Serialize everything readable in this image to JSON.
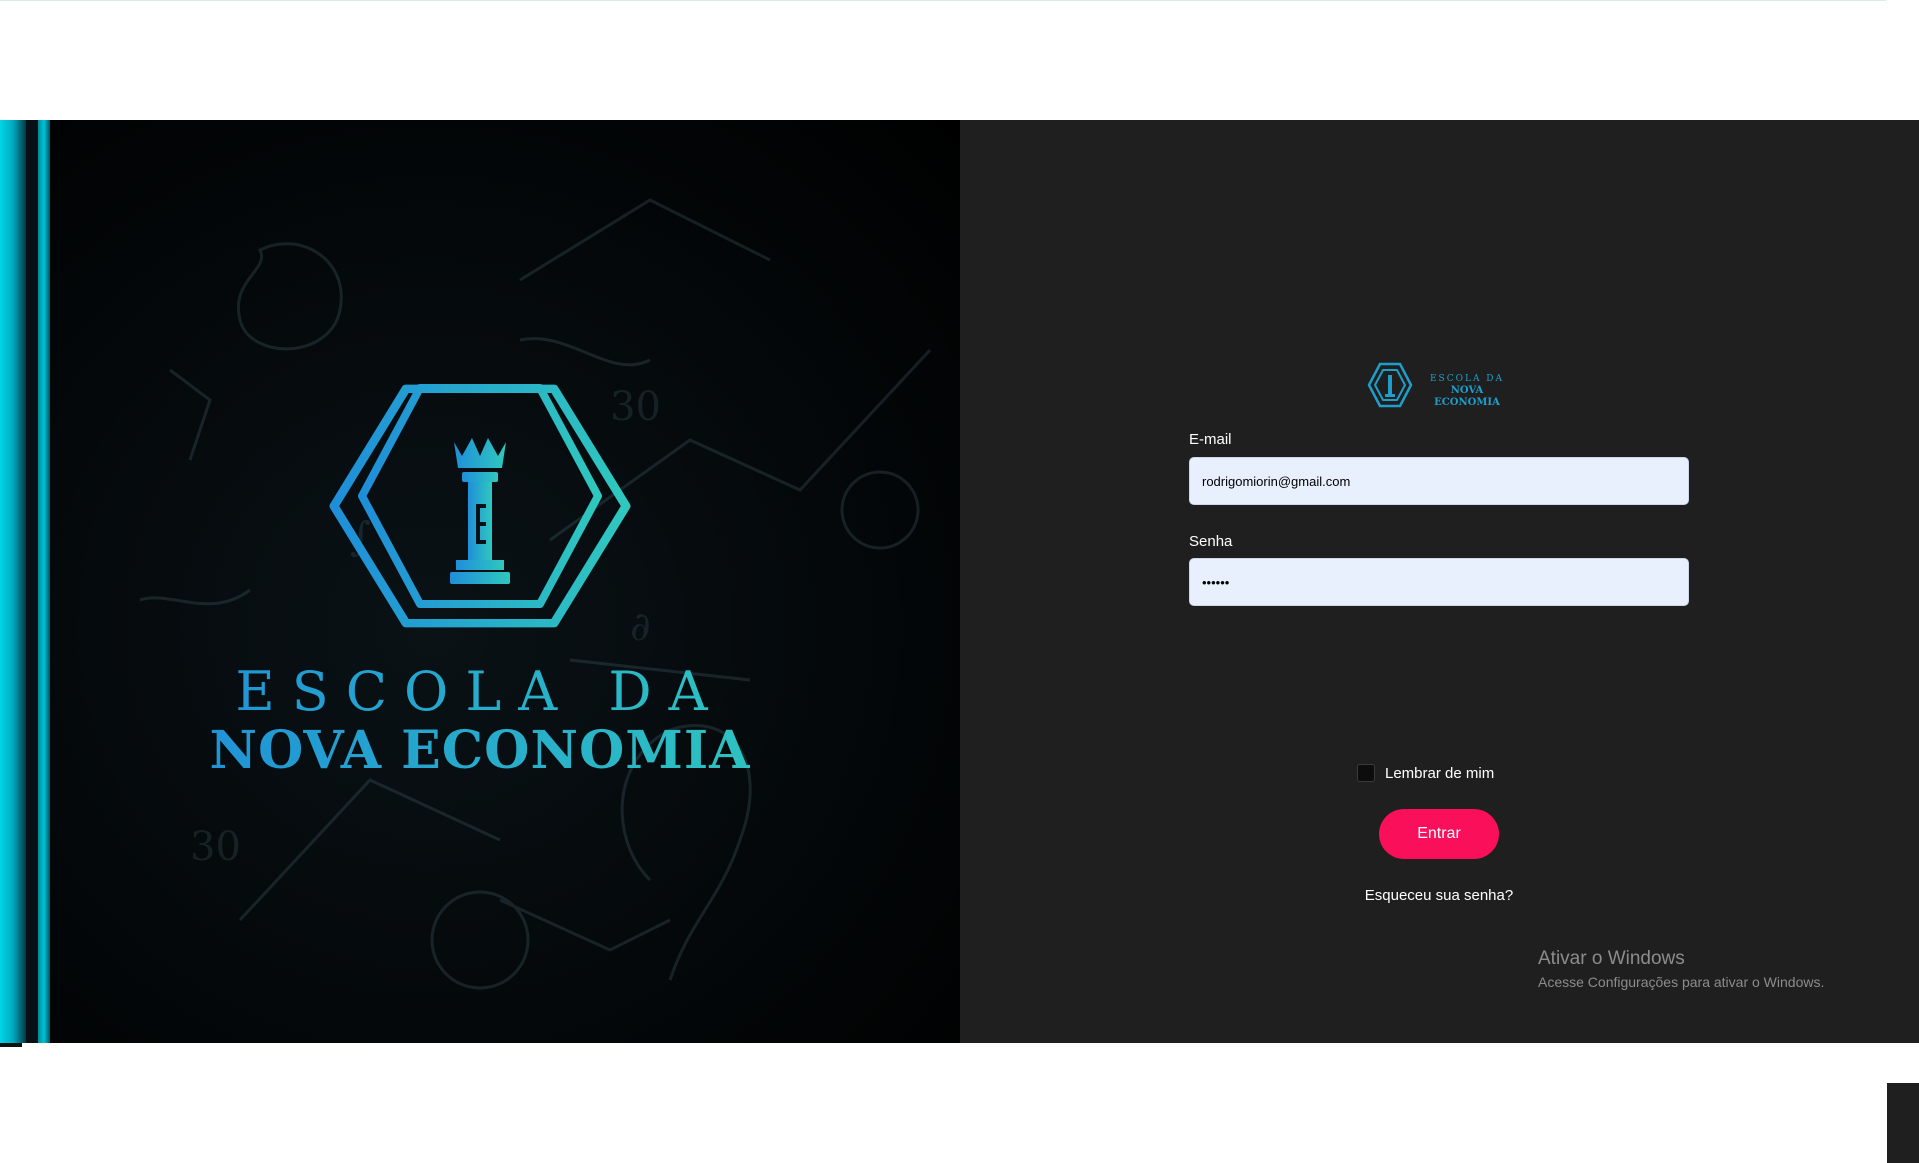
{
  "hero": {
    "brand_line1": "ESCOLA DA",
    "brand_line2": "NOVA ECONOMIA",
    "logo_icon": "rook-crown-hexagon-icon"
  },
  "login": {
    "mini_logo_line1": "ESCOLA DA",
    "mini_logo_line2": "NOVA ECONOMIA",
    "email_label": "E-mail",
    "email_value": "rodrigomiorin@gmail.com",
    "password_label": "Senha",
    "password_value": "••••••",
    "remember_label": "Lembrar de mim",
    "remember_checked": false,
    "submit_label": "Entrar",
    "forgot_label": "Esqueceu sua senha?"
  },
  "watermark": {
    "title": "Ativar o Windows",
    "subtitle": "Acesse Configurações para ativar o Windows."
  },
  "colors": {
    "accent": "#fa0f5a",
    "brand_cyan": "#23a6d6",
    "panel_bg": "#1f1f1f",
    "input_bg": "#e8f0fe"
  }
}
